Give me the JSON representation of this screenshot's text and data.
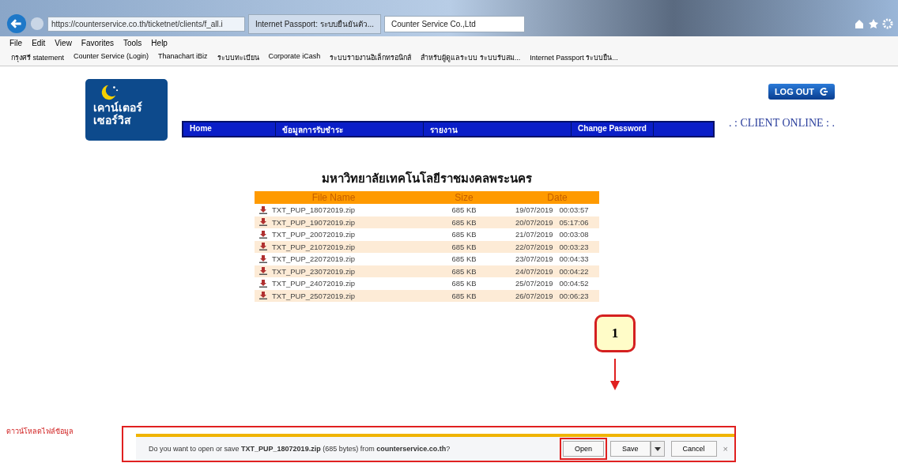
{
  "browser": {
    "address": "https://counterservice.co.th/ticketnet/clients/f_all.i",
    "tabs": [
      {
        "label": "Internet Passport: ระบบยืนยันตัว...",
        "selected": false
      },
      {
        "label": "Counter Service Co.,Ltd",
        "selected": true
      }
    ],
    "menu": [
      "File",
      "Edit",
      "View",
      "Favorites",
      "Tools",
      "Help"
    ],
    "favorites": [
      "กรุงศรี statement",
      "Counter Service (Login)",
      "Thanachart iBiz",
      "ระบบทะเบียน",
      "Corporate iCash",
      "ระบบรายงานอิเล็กทรอนิกส์",
      "สำหรับผู้ดูแลระบบ ระบบรับสม...",
      "Internet Passport ระบบยืน..."
    ]
  },
  "page": {
    "logo_text": [
      "เคาน์เตอร์",
      "เซอร์วิส"
    ],
    "logout": "LOG OUT",
    "client_label": ". :  CLIENT ONLINE  : .",
    "nav": [
      "Home",
      "ข้อมูลการรับชำระ",
      "รายงาน",
      "Change Password"
    ],
    "table_title": "มหาวิทยาลัยเทคโนโลยีราชมงคลพระนคร",
    "columns": [
      "File Name",
      "Size",
      "Date"
    ],
    "rows": [
      [
        "TXT_PUP_18072019.zip",
        "685 KB",
        "19/07/2019",
        "00:03:57"
      ],
      [
        "TXT_PUP_19072019.zip",
        "685 KB",
        "20/07/2019",
        "05:17:06"
      ],
      [
        "TXT_PUP_20072019.zip",
        "685 KB",
        "21/07/2019",
        "00:03:08"
      ],
      [
        "TXT_PUP_21072019.zip",
        "685 KB",
        "22/07/2019",
        "00:03:23"
      ],
      [
        "TXT_PUP_22072019.zip",
        "685 KB",
        "23/07/2019",
        "00:04:33"
      ],
      [
        "TXT_PUP_23072019.zip",
        "685 KB",
        "24/07/2019",
        "00:04:22"
      ],
      [
        "TXT_PUP_24072019.zip",
        "685 KB",
        "25/07/2019",
        "00:04:52"
      ],
      [
        "TXT_PUP_25072019.zip",
        "685 KB",
        "26/07/2019",
        "00:06:23"
      ]
    ],
    "note": "ดาวน์โหลดไฟล์ข้อมูล"
  },
  "callout": "1",
  "download_bar": {
    "message": "Do you want to open or save **TXT_PUP_18072019.zip** (685 bytes) from **counterservice.co.th**?",
    "buttons": [
      "Open",
      "Save",
      "Cancel"
    ],
    "close": "×"
  }
}
